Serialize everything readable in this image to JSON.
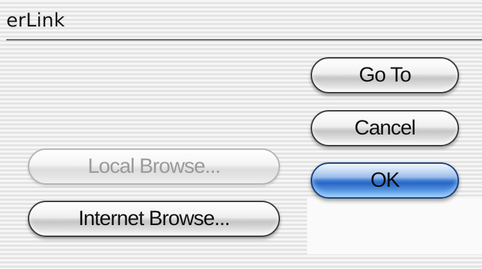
{
  "window": {
    "title": "erLink"
  },
  "buttons": {
    "go_to": "Go To",
    "cancel": "Cancel",
    "ok": "OK",
    "local_browse": "Local Browse...",
    "internet_browse": "Internet Browse..."
  },
  "states": {
    "local_browse_enabled": false,
    "default_button": "OK"
  },
  "colors": {
    "default_button": "#3f7fd4",
    "disabled_text": "#9a9a9a",
    "text": "#111111"
  }
}
